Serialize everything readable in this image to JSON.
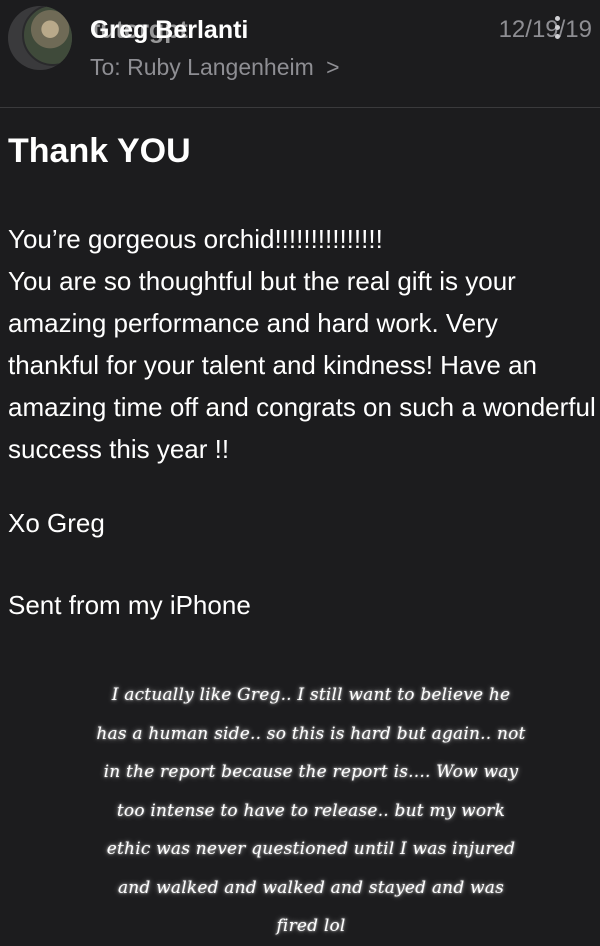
{
  "header": {
    "sender_name": "Greg Berlanti",
    "sender_name_overlap": "tutorgpt",
    "to_label": "To:",
    "recipient": "Ruby Langenheim",
    "chevron": ">",
    "date": "12/19/19"
  },
  "message": {
    "subject": "Thank YOU",
    "body_lines": [
      "You’re gorgeous orchid!!!!!!!!!!!!!!!",
      "You are so thoughtful but the real gift is your amazing performance and hard work.  Very thankful for your talent and kindness!  Have an amazing time off and congrats on such a wonderful success this year !!"
    ],
    "signoff": "Xo Greg",
    "signature": "Sent from my iPhone"
  },
  "overlay_note": {
    "text": "I actually like Greg.. I still want to believe he has a human side.. so this is hard but again.. not in the report because the report is.... Wow way too intense to have to release.. but my work ethic was never questioned until I was injured and walked and walked and stayed and was fired lol"
  },
  "colors": {
    "background": "#1c1c1e",
    "primary_text": "#ffffff",
    "secondary_text": "#8e8e93"
  }
}
